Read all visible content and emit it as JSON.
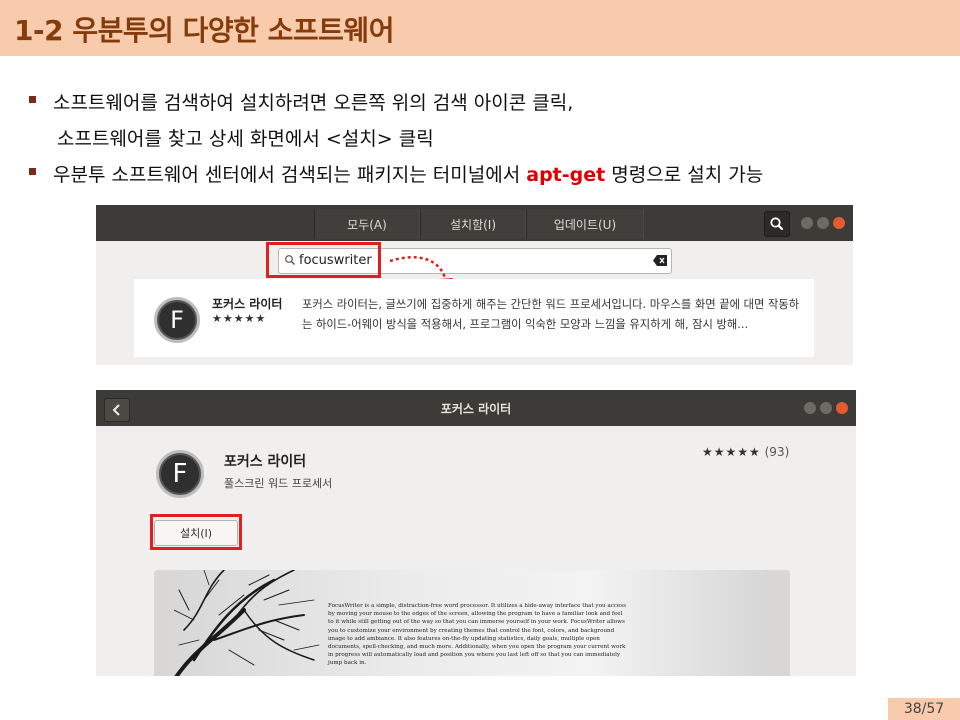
{
  "slide": {
    "title": "1-2 우분투의 다양한 소프트웨어",
    "page_number": "38/57",
    "accent_color": "#f8cbad",
    "title_color": "#843c0c"
  },
  "bullets": {
    "b1_line1": "소프트웨어를 검색하여 설치하려면 오른쪽 위의 검색 아이콘 클릭,",
    "b1_line2": "소프트웨어를 찾고 상세 화면에서 <설치> 클릭",
    "b2_prefix": "우분투 소프트웨어 센터에서 검색되는 패키지는 터미널에서 ",
    "b2_highlight": "apt-get",
    "b2_suffix": " 명령으로 설치 가능",
    "highlight_color": "#e00000"
  },
  "search_screen": {
    "tabs": [
      "모두(A)",
      "설치함(I)",
      "업데이트(U)"
    ],
    "search_value": "focuswriter",
    "search_icon": "search-icon",
    "clear_icon": "backspace-icon",
    "result": {
      "name": "포커스 라이터",
      "stars": "★★★★★",
      "description": "포커스 라이터는, 글쓰기에 집중하게 해주는 간단한 워드 프로세서입니다. 마우스를 화면 끝에 대면 작동하는 하이드-어웨이 방식을 적용해서, 프로그램이 익숙한 모양과 느낌을 유지하게 해, 잠시 방해...",
      "icon_letter": "F"
    }
  },
  "detail_screen": {
    "window_title": "포커스 라이터",
    "back_icon": "chevron-left-icon",
    "app_name": "포커스 라이터",
    "app_subtitle": "풀스크린 워드 프로세서",
    "icon_letter": "F",
    "stars": "★★★★★",
    "rating_count": "(93)",
    "install_label": "설치(I)",
    "preview_text": "FocusWriter is a simple, distraction-free word processor. It utilizes a hide-away interface that you access by moving your mouse to the edges of the screen, allowing the program to have a familiar look and feel to it while still getting out of the way so that you can immerse yourself in your work. FocusWriter allows you to customize your environment by creating themes that control the font, colors, and background image to add ambiance. It also features on-the-fly updating statistics, daily goals, multiple open documents, spell-checking, and much more. Additionally, when you open the program your current work in progress will automatically load and position you where you last left off so that you can immediately jump back in."
  }
}
